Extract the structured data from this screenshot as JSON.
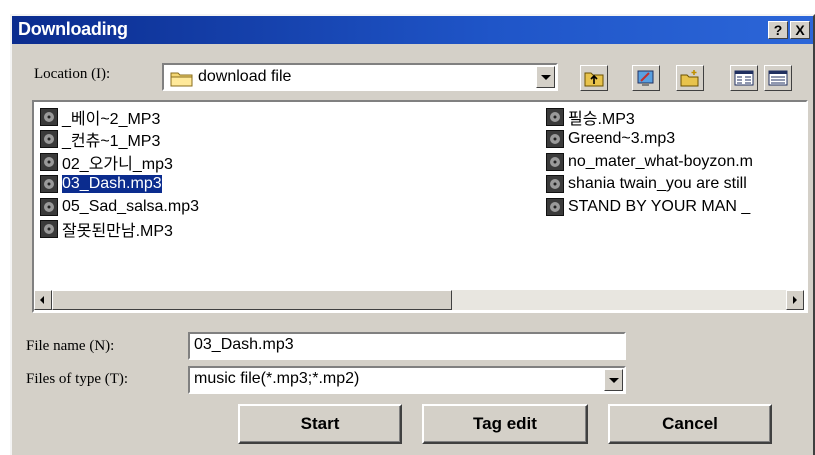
{
  "dialog": {
    "title": "Downloading",
    "help_label": "?",
    "close_label": "X"
  },
  "location": {
    "label": "Location (I):",
    "value": "download file"
  },
  "toolbar": {
    "buttons": [
      "up-folder",
      "desktop",
      "new-folder",
      "list-view",
      "details-view"
    ]
  },
  "files": {
    "column1": [
      "_베이~2_MP3",
      "_컨츄~1_MP3",
      "02_오가니_mp3",
      "03_Dash.mp3",
      "05_Sad_salsa.mp3",
      "잘못된만남.MP3"
    ],
    "column2": [
      "필승.MP3",
      "Greend~3.mp3",
      "no_mater_what-boyzon.m",
      "shania twain_you are still",
      "STAND BY YOUR MAN _"
    ],
    "selected": "03_Dash.mp3"
  },
  "file_name": {
    "label": "File name (N):",
    "value": "03_Dash.mp3"
  },
  "file_type": {
    "label": "Files of type (T):",
    "value": "music file(*.mp3;*.mp2)"
  },
  "buttons": {
    "start": "Start",
    "tag_edit": "Tag edit",
    "cancel": "Cancel"
  },
  "colors": {
    "title_bar": "#0b2c8e",
    "face": "#d4d0c8",
    "selection": "#0b2c8e"
  }
}
